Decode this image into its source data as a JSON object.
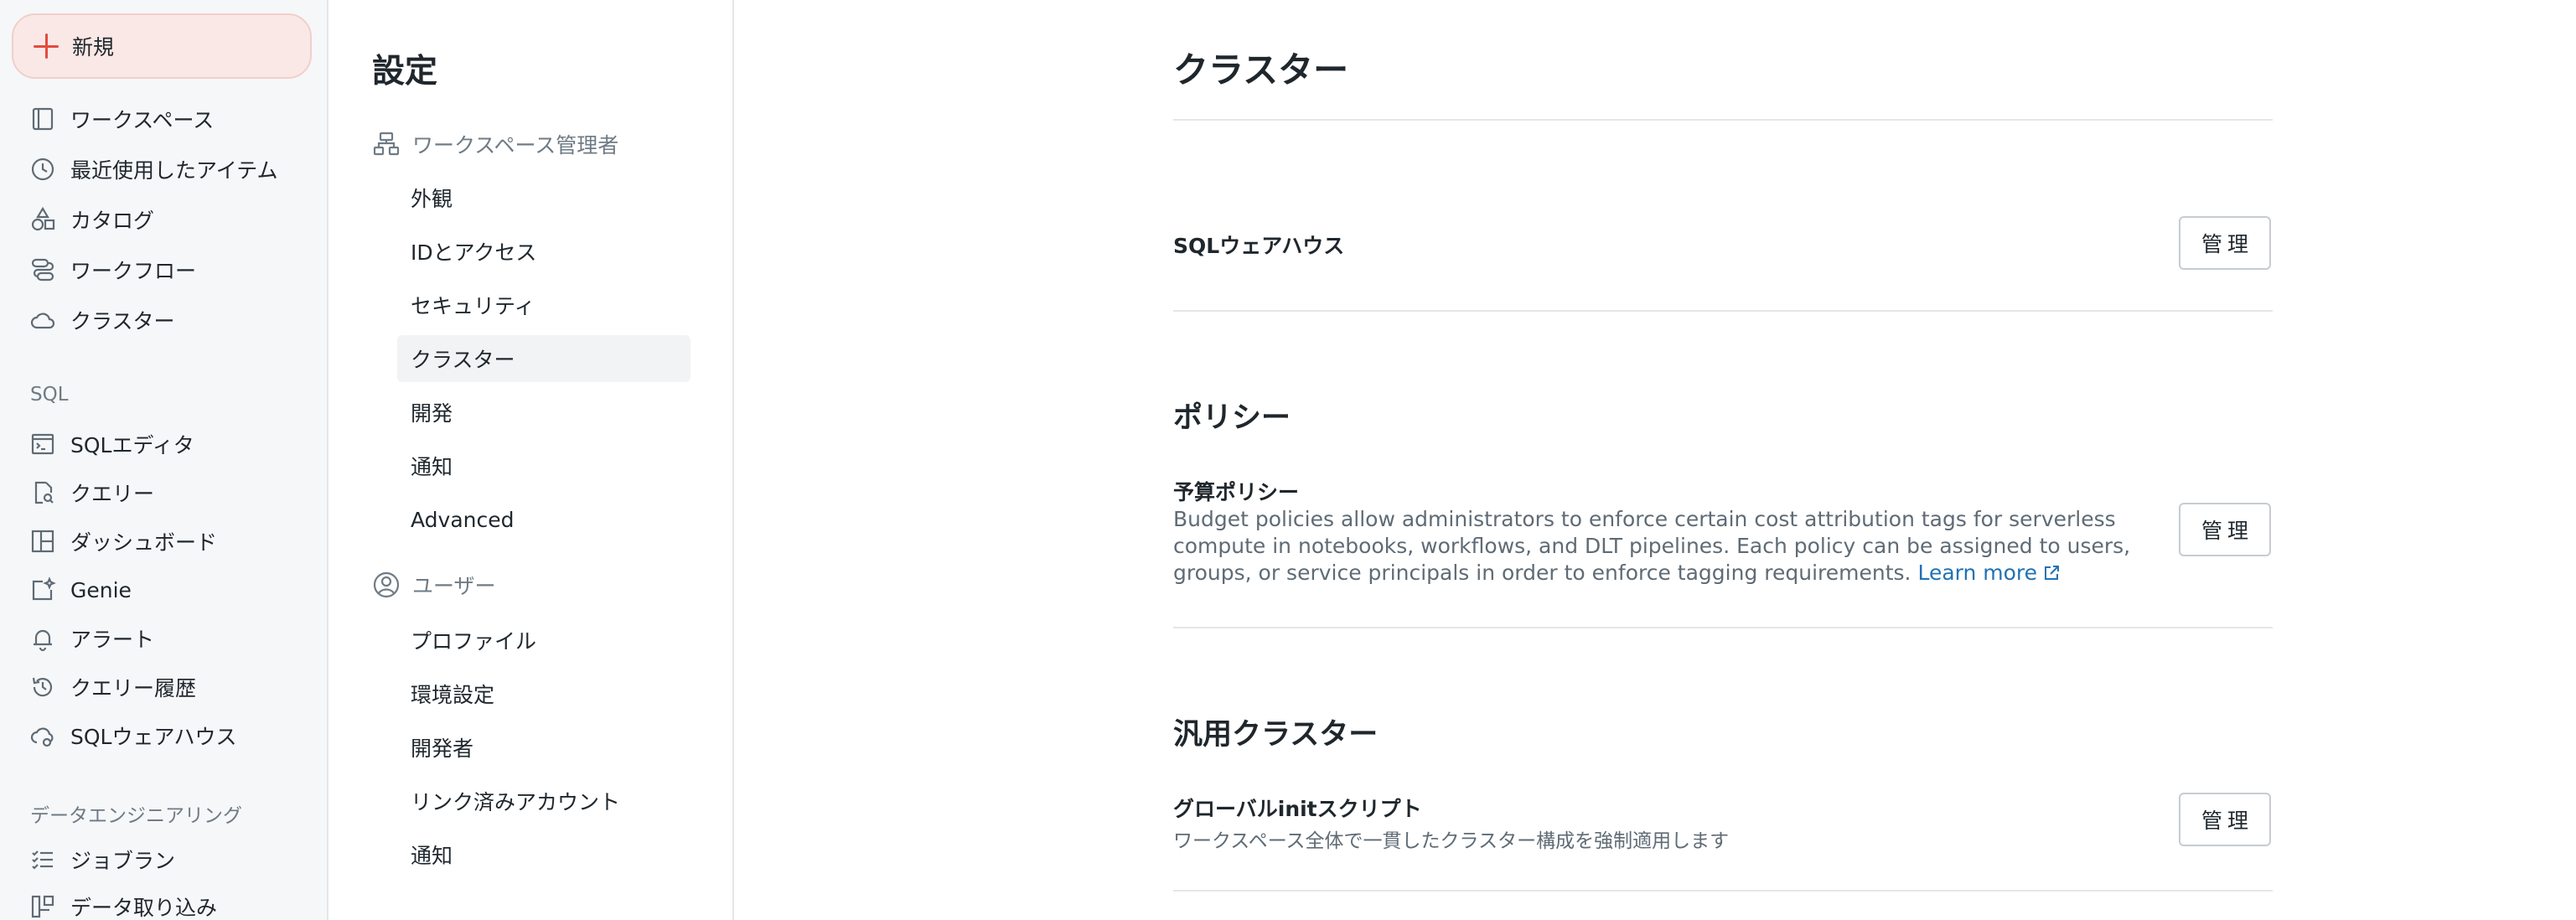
{
  "nav": {
    "new_label": "新規",
    "items": [
      {
        "label": "ワークスペース",
        "icon": "workspace-icon"
      },
      {
        "label": "最近使用したアイテム",
        "icon": "clock-icon"
      },
      {
        "label": "カタログ",
        "icon": "catalog-icon"
      },
      {
        "label": "ワークフロー",
        "icon": "workflow-icon"
      },
      {
        "label": "クラスター",
        "icon": "cloud-icon"
      }
    ],
    "sql_section": "SQL",
    "sql_items": [
      {
        "label": "SQLエディタ",
        "icon": "sql-editor-icon"
      },
      {
        "label": "クエリー",
        "icon": "query-icon"
      },
      {
        "label": "ダッシュボード",
        "icon": "dashboard-icon"
      },
      {
        "label": "Genie",
        "icon": "genie-icon"
      },
      {
        "label": "アラート",
        "icon": "bell-icon"
      },
      {
        "label": "クエリー履歴",
        "icon": "history-icon"
      },
      {
        "label": "SQLウェアハウス",
        "icon": "warehouse-icon"
      }
    ],
    "de_section": "データエンジニアリング",
    "de_items": [
      {
        "label": "ジョブラン",
        "icon": "job-runs-icon"
      },
      {
        "label": "データ取り込み",
        "icon": "data-ingest-icon"
      }
    ]
  },
  "settings": {
    "title": "設定",
    "admin_group": "ワークスペース管理者",
    "admin_items": [
      "外観",
      "IDとアクセス",
      "セキュリティ",
      "クラスター",
      "開発",
      "通知",
      "Advanced"
    ],
    "active_item": "クラスター",
    "user_group": "ユーザー",
    "user_items": [
      "プロファイル",
      "環境設定",
      "開発者",
      "リンク済みアカウント",
      "通知"
    ]
  },
  "content": {
    "title": "クラスター",
    "manage_label": "管理",
    "sql_warehouse": {
      "title": "SQLウェアハウス"
    },
    "policies": {
      "title": "ポリシー",
      "budget_title": "予算ポリシー",
      "budget_desc": "Budget policies allow administrators to enforce certain cost attribution tags for serverless compute in notebooks, workflows, and DLT pipelines. Each policy can be assigned to users, groups, or service principals in order to enforce tagging requirements.",
      "learn_more": "Learn more"
    },
    "all_purpose": {
      "title": "汎用クラスター",
      "init_title": "グローバルinitスクリプト",
      "init_desc": "ワークスペース全体で一貫したクラスター構成を強制適用します"
    }
  },
  "colors": {
    "accent": "#e24b3d",
    "link": "#2272b4",
    "nav_bg": "#f6f7f9",
    "new_bg": "#fae8e6"
  }
}
